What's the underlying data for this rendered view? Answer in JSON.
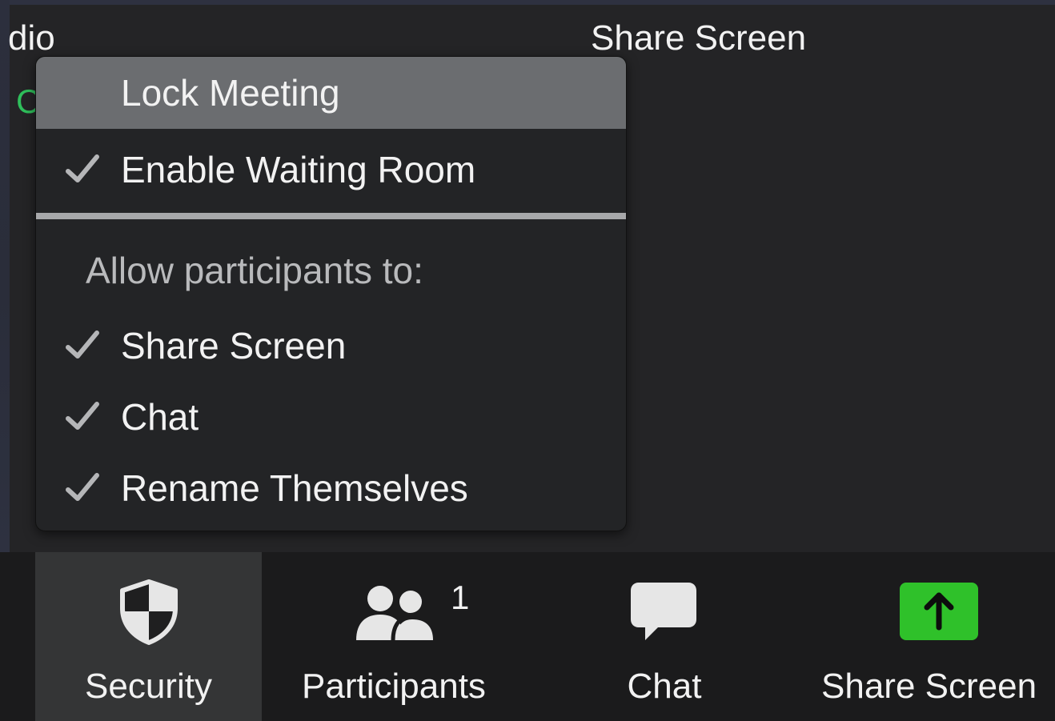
{
  "background_partials": {
    "audio_label_fragment": "dio",
    "share_screen_top": "Share Screen",
    "green_fragment": "C"
  },
  "security_menu": {
    "items_top": [
      {
        "label": "Lock Meeting",
        "checked": false,
        "highlighted": true
      },
      {
        "label": "Enable Waiting Room",
        "checked": true,
        "highlighted": false
      }
    ],
    "section_title": "Allow participants to:",
    "items_bottom": [
      {
        "label": "Share Screen",
        "checked": true
      },
      {
        "label": "Chat",
        "checked": true
      },
      {
        "label": "Rename Themselves",
        "checked": true
      }
    ]
  },
  "toolbar": {
    "security_label": "Security",
    "participants_label": "Participants",
    "participants_count": "1",
    "chat_label": "Chat",
    "share_screen_label": "Share Screen"
  },
  "colors": {
    "menu_highlight": "#6b6d70",
    "share_button_green": "#2fc12a",
    "check_color": "#b5b6b8",
    "green_text": "#2fbf5b"
  },
  "icons": {
    "security": "shield-icon",
    "participants": "participants-icon",
    "chat": "chat-bubble-icon",
    "share": "share-screen-arrow-icon",
    "check": "checkmark-icon"
  }
}
